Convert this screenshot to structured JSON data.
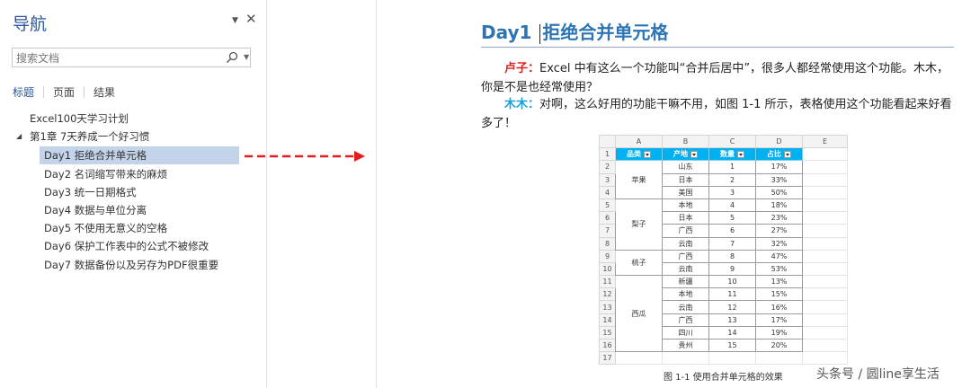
{
  "nav": {
    "title": "导航",
    "menu_glyph": "▼",
    "close_glyph": "✕",
    "search_placeholder": "搜索文档",
    "search_dropdown_glyph": "▼",
    "tabs": [
      "标题",
      "页面",
      "结果"
    ],
    "active_tab": 0,
    "caret_glyph": "◢",
    "tree": [
      {
        "label": "Excel100天学习计划"
      },
      {
        "label": "第1章 7天养成一个好习惯"
      },
      {
        "label": "Day1 拒绝合并单元格",
        "selected": true
      },
      {
        "label": "Day2 名词缩写带来的麻烦"
      },
      {
        "label": "Day3 统一日期格式"
      },
      {
        "label": "Day4 数据与单位分离"
      },
      {
        "label": "Day5 不使用无意义的空格"
      },
      {
        "label": "Day6 保护工作表中的公式不被修改"
      },
      {
        "label": "Day7 数据备份以及另存为PDF很重要"
      }
    ]
  },
  "arrow_color": "#e02020",
  "document": {
    "heading": {
      "prefix": "Day1",
      "text": "拒绝合并单元格"
    },
    "para1": {
      "speaker": "卢子：",
      "text": "Excel 中有这么一个功能叫“合并后居中”，很多人都经常使用这个功能。木木，你是不是也经常使用？"
    },
    "para2": {
      "speaker": "木木：",
      "text": "对啊，这么好用的功能干嘛不用，如图 1-1 所示，表格使用这个功能看起来好看多了！"
    },
    "sheet": {
      "columns": [
        "A",
        "B",
        "C",
        "D",
        "E"
      ],
      "headers": [
        "品类",
        "产地",
        "数量",
        "占比"
      ],
      "rows": [
        [
          "苹果",
          "山东",
          "1",
          "17%"
        ],
        [
          "",
          "日本",
          "2",
          "33%"
        ],
        [
          "",
          "美国",
          "3",
          "50%"
        ],
        [
          "梨子",
          "本地",
          "4",
          "18%"
        ],
        [
          "",
          "日本",
          "5",
          "23%"
        ],
        [
          "",
          "广西",
          "6",
          "27%"
        ],
        [
          "",
          "云南",
          "7",
          "32%"
        ],
        [
          "桃子",
          "广西",
          "8",
          "47%"
        ],
        [
          "",
          "云南",
          "9",
          "53%"
        ],
        [
          "西瓜",
          "新疆",
          "10",
          "13%"
        ],
        [
          "",
          "本地",
          "11",
          "15%"
        ],
        [
          "",
          "云南",
          "12",
          "16%"
        ],
        [
          "",
          "广西",
          "13",
          "17%"
        ],
        [
          "",
          "四川",
          "14",
          "19%"
        ],
        [
          "",
          "贵州",
          "15",
          "20%"
        ]
      ],
      "groups": [
        {
          "label": "苹果",
          "span": 3
        },
        {
          "label": "梨子",
          "span": 4
        },
        {
          "label": "桃子",
          "span": 2
        },
        {
          "label": "西瓜",
          "span": 6
        }
      ],
      "row_numbers": [
        "1",
        "2",
        "3",
        "4",
        "5",
        "6",
        "7",
        "8",
        "9",
        "10",
        "11",
        "12",
        "13",
        "14",
        "15",
        "16",
        "17"
      ]
    },
    "caption": "图 1-1 使用合并单元格的效果",
    "watermark": "头条号 / 圆line享生活"
  }
}
